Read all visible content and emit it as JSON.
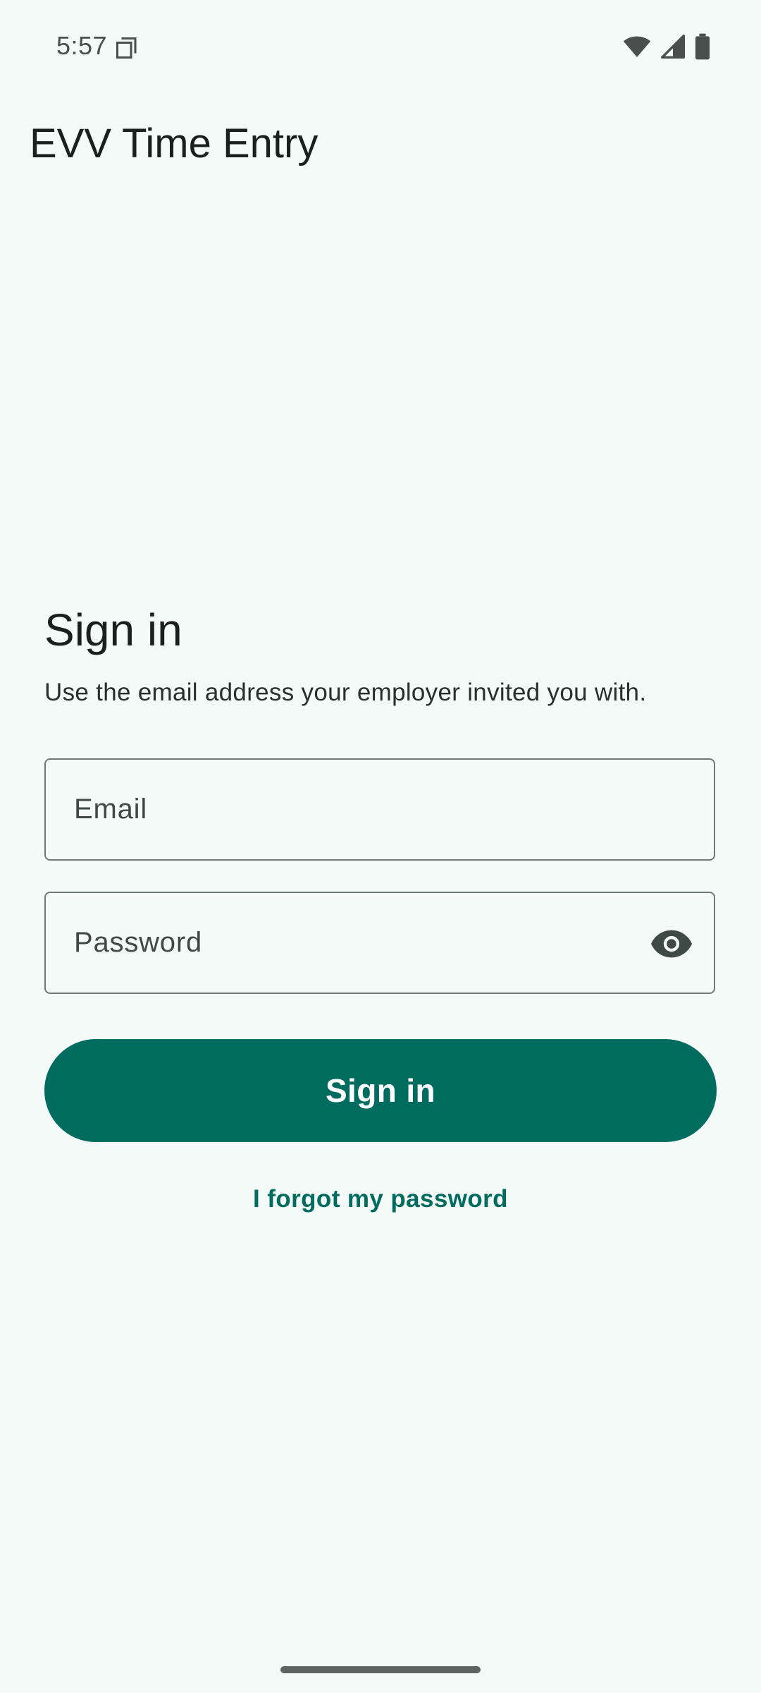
{
  "status_bar": {
    "time": "5:57",
    "icons": [
      "screenshot-icon",
      "wifi-icon",
      "cell-signal-icon",
      "battery-icon"
    ]
  },
  "app_bar": {
    "title": "EVV Time Entry"
  },
  "sign_in": {
    "heading": "Sign in",
    "subtitle": "Use the email address your employer invited you with.",
    "email": {
      "placeholder": "Email",
      "value": ""
    },
    "password": {
      "placeholder": "Password",
      "value": "",
      "toggle_icon": "eye-icon"
    },
    "submit_label": "Sign in",
    "forgot_label": "I forgot my password"
  },
  "colors": {
    "background": "#f4faf8",
    "primary": "#006b5f",
    "outline": "#6f7975",
    "on_primary": "#ffffff",
    "text": "#1b1f1e"
  }
}
